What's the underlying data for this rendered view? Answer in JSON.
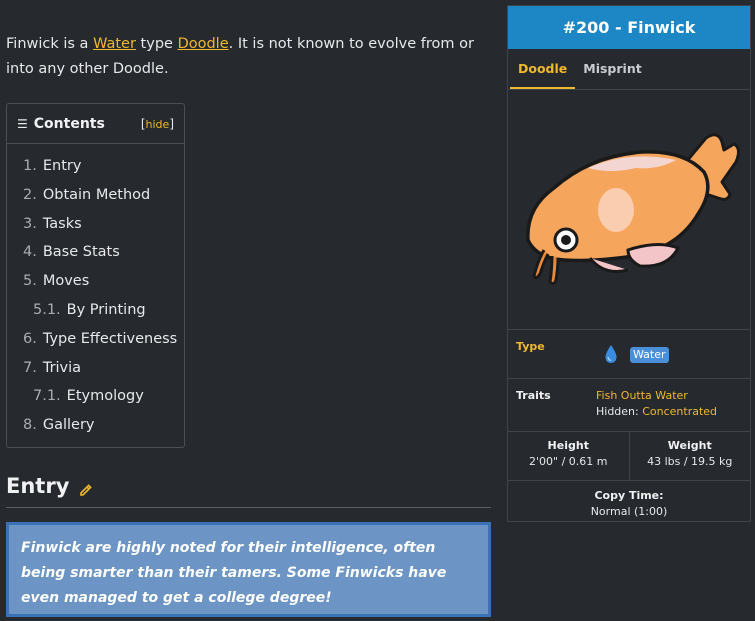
{
  "intro": {
    "part1": "Finwick is a ",
    "type_link": "Water",
    "part2": " type ",
    "doodle_link": "Doodle",
    "part3": ". It is not known to evolve from or into any other Doodle."
  },
  "toc": {
    "title": "Contents",
    "hide_label": "hide",
    "items": [
      {
        "num": "1.",
        "label": "Entry"
      },
      {
        "num": "2.",
        "label": "Obtain Method"
      },
      {
        "num": "3.",
        "label": "Tasks"
      },
      {
        "num": "4.",
        "label": "Base Stats"
      },
      {
        "num": "5.",
        "label": "Moves"
      },
      {
        "num": "5.1.",
        "label": "By Printing"
      },
      {
        "num": "6.",
        "label": "Type Effectiveness"
      },
      {
        "num": "7.",
        "label": "Trivia"
      },
      {
        "num": "7.1.",
        "label": "Etymology"
      },
      {
        "num": "8.",
        "label": "Gallery"
      }
    ]
  },
  "entry": {
    "heading": "Entry",
    "quote": "Finwick are highly noted for their intelligence, often being smarter than their tamers. Some Finwicks have even managed to get a college degree!"
  },
  "infobox": {
    "title": "#200 - Finwick",
    "tabs": [
      "Doodle",
      "Misprint"
    ],
    "type_label": "Type",
    "type_value": "Water",
    "traits_label": "Traits",
    "trait_main": "Fish Outta Water",
    "hidden_prefix": "Hidden: ",
    "trait_hidden": "Concentrated",
    "height_label": "Height",
    "height_value": "2'00\" / 0.61 m",
    "weight_label": "Weight",
    "weight_value": "43 lbs / 19.5 kg",
    "copy_label": "Copy Time:",
    "copy_value": "Normal (1:00)"
  },
  "colors": {
    "accent": "#f0b82e",
    "title_bar": "#1d87c6",
    "water_badge": "#4b8fd9",
    "quote_bg": "#6c94c4"
  }
}
